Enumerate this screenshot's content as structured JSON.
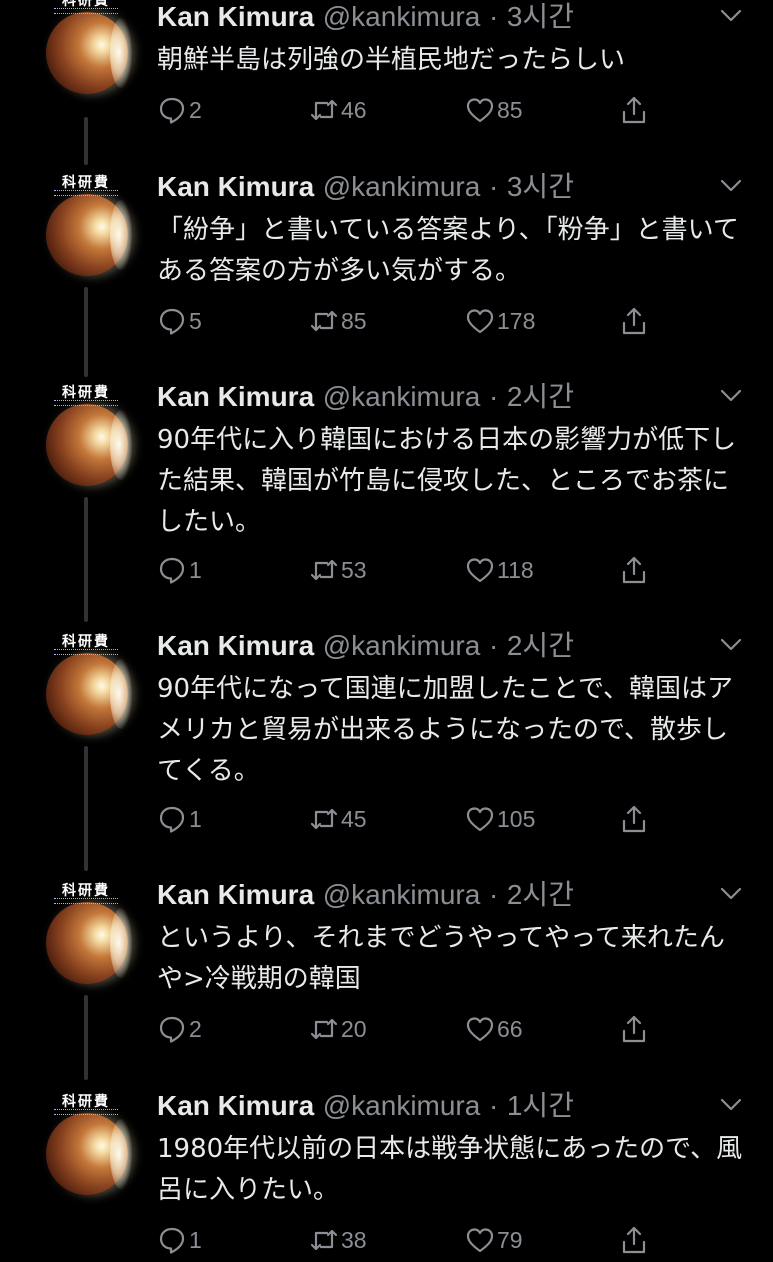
{
  "avatar_logo": "科研費",
  "colors": {
    "background": "#000000",
    "text": "#e7e9ea",
    "secondary": "#8b8f94",
    "thread_line": "#2f3336"
  },
  "icons": {
    "reply": "reply-icon",
    "retweet": "retweet-icon",
    "like": "heart-icon",
    "share": "share-icon",
    "more": "chevron-down-icon"
  },
  "tweets": [
    {
      "name": "Kan Kimura",
      "handle": "@kankimura",
      "separator": "·",
      "time": "3시간",
      "text": "朝鮮半島は列強の半植民地だったらしい",
      "replies": "2",
      "retweets": "46",
      "likes": "85"
    },
    {
      "name": "Kan Kimura",
      "handle": "@kankimura",
      "separator": "·",
      "time": "3시간",
      "text": "「紛争」と書いている答案より、「粉争」と書いてある答案の方が多い気がする。",
      "replies": "5",
      "retweets": "85",
      "likes": "178"
    },
    {
      "name": "Kan Kimura",
      "handle": "@kankimura",
      "separator": "·",
      "time": "2시간",
      "text": "90年代に入り韓国における日本の影響力が低下した結果、韓国が竹島に侵攻した、ところでお茶にしたい。",
      "replies": "1",
      "retweets": "53",
      "likes": "118"
    },
    {
      "name": "Kan Kimura",
      "handle": "@kankimura",
      "separator": "·",
      "time": "2시간",
      "text": "90年代になって国連に加盟したことで、韓国はアメリカと貿易が出来るようになったので、散歩してくる。",
      "replies": "1",
      "retweets": "45",
      "likes": "105"
    },
    {
      "name": "Kan Kimura",
      "handle": "@kankimura",
      "separator": "·",
      "time": "2시간",
      "text": "というより、それまでどうやってやって来れたんや>冷戦期の韓国",
      "replies": "2",
      "retweets": "20",
      "likes": "66"
    },
    {
      "name": "Kan Kimura",
      "handle": "@kankimura",
      "separator": "·",
      "time": "1시간",
      "text": "1980年代以前の日本は戦争状態にあったので、風呂に入りたい。",
      "replies": "1",
      "retweets": "38",
      "likes": "79"
    }
  ]
}
